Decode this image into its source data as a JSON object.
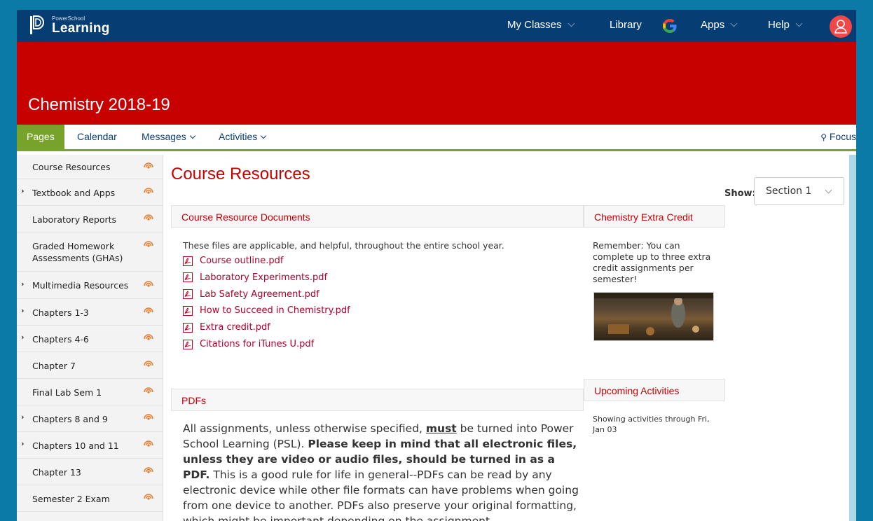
{
  "app": {
    "logo_small": "PowerSchool",
    "logo_big": "Learning"
  },
  "topnav": {
    "my_classes": "My Classes",
    "library": "Library",
    "apps": "Apps",
    "help": "Help"
  },
  "banner": {
    "title": "Chemistry 2018-19"
  },
  "tabs": {
    "pages": "Pages",
    "calendar": "Calendar",
    "messages": "Messages",
    "activities": "Activities",
    "focus": "Focus"
  },
  "sidebar": {
    "items": [
      {
        "label": "Course Resources",
        "expandable": false
      },
      {
        "label": "Textbook and Apps",
        "expandable": true
      },
      {
        "label": "Laboratory Reports",
        "expandable": false
      },
      {
        "label": "Graded Homework Assessments (GHAs)",
        "expandable": false
      },
      {
        "label": "Multimedia Resources",
        "expandable": true
      },
      {
        "label": "Chapters 1-3",
        "expandable": true
      },
      {
        "label": "Chapters 4-6",
        "expandable": true
      },
      {
        "label": "Chapter 7",
        "expandable": false
      },
      {
        "label": "Final Lab Sem 1",
        "expandable": false
      },
      {
        "label": "Chapters 8 and 9",
        "expandable": true
      },
      {
        "label": "Chapters 10 and 11",
        "expandable": true
      },
      {
        "label": "Chapter 13",
        "expandable": false
      },
      {
        "label": "Semester 2 Exam",
        "expandable": false
      }
    ]
  },
  "main": {
    "title": "Course Resources",
    "show_label": "Show:",
    "show_value": "Section 1",
    "documents": {
      "heading": "Course Resource Documents",
      "intro": "These files are applicable, and helpful, throughout the entire school year.",
      "files": [
        "Course outline.pdf",
        "Laboratory Experiments.pdf",
        "Lab Safety Agreement.pdf",
        "How to Succeed in Chemistry.pdf",
        "Extra credit.pdf",
        "Citations for iTunes U.pdf"
      ]
    },
    "extra_credit": {
      "heading": "Chemistry Extra Credit",
      "text": "Remember: You can complete up to three extra credit assignments per semester!"
    },
    "upcoming": {
      "heading": "Upcoming Activities",
      "text": "Showing activities through Fri, Jan 03"
    },
    "pdfs": {
      "heading": "PDFs",
      "p1": "All assignments, unless otherwise specified, ",
      "must": "must",
      "p2": " be turned into Power School Learning (PSL). ",
      "bold": "Please keep in mind that all electronic files, unless they are video or audio files, should be turned in as a PDF.",
      "p3": " This is a good rule for life in general--PDFs can be read by any electronic device while other file formats can have problems when going from one device to another. PDFs also preserve your original formatting, which might be important depending on the assignment."
    }
  },
  "colors": {
    "nav": "#063d73",
    "banner": "#c70000",
    "active_tab": "#77a22b",
    "link": "#b0002a"
  }
}
